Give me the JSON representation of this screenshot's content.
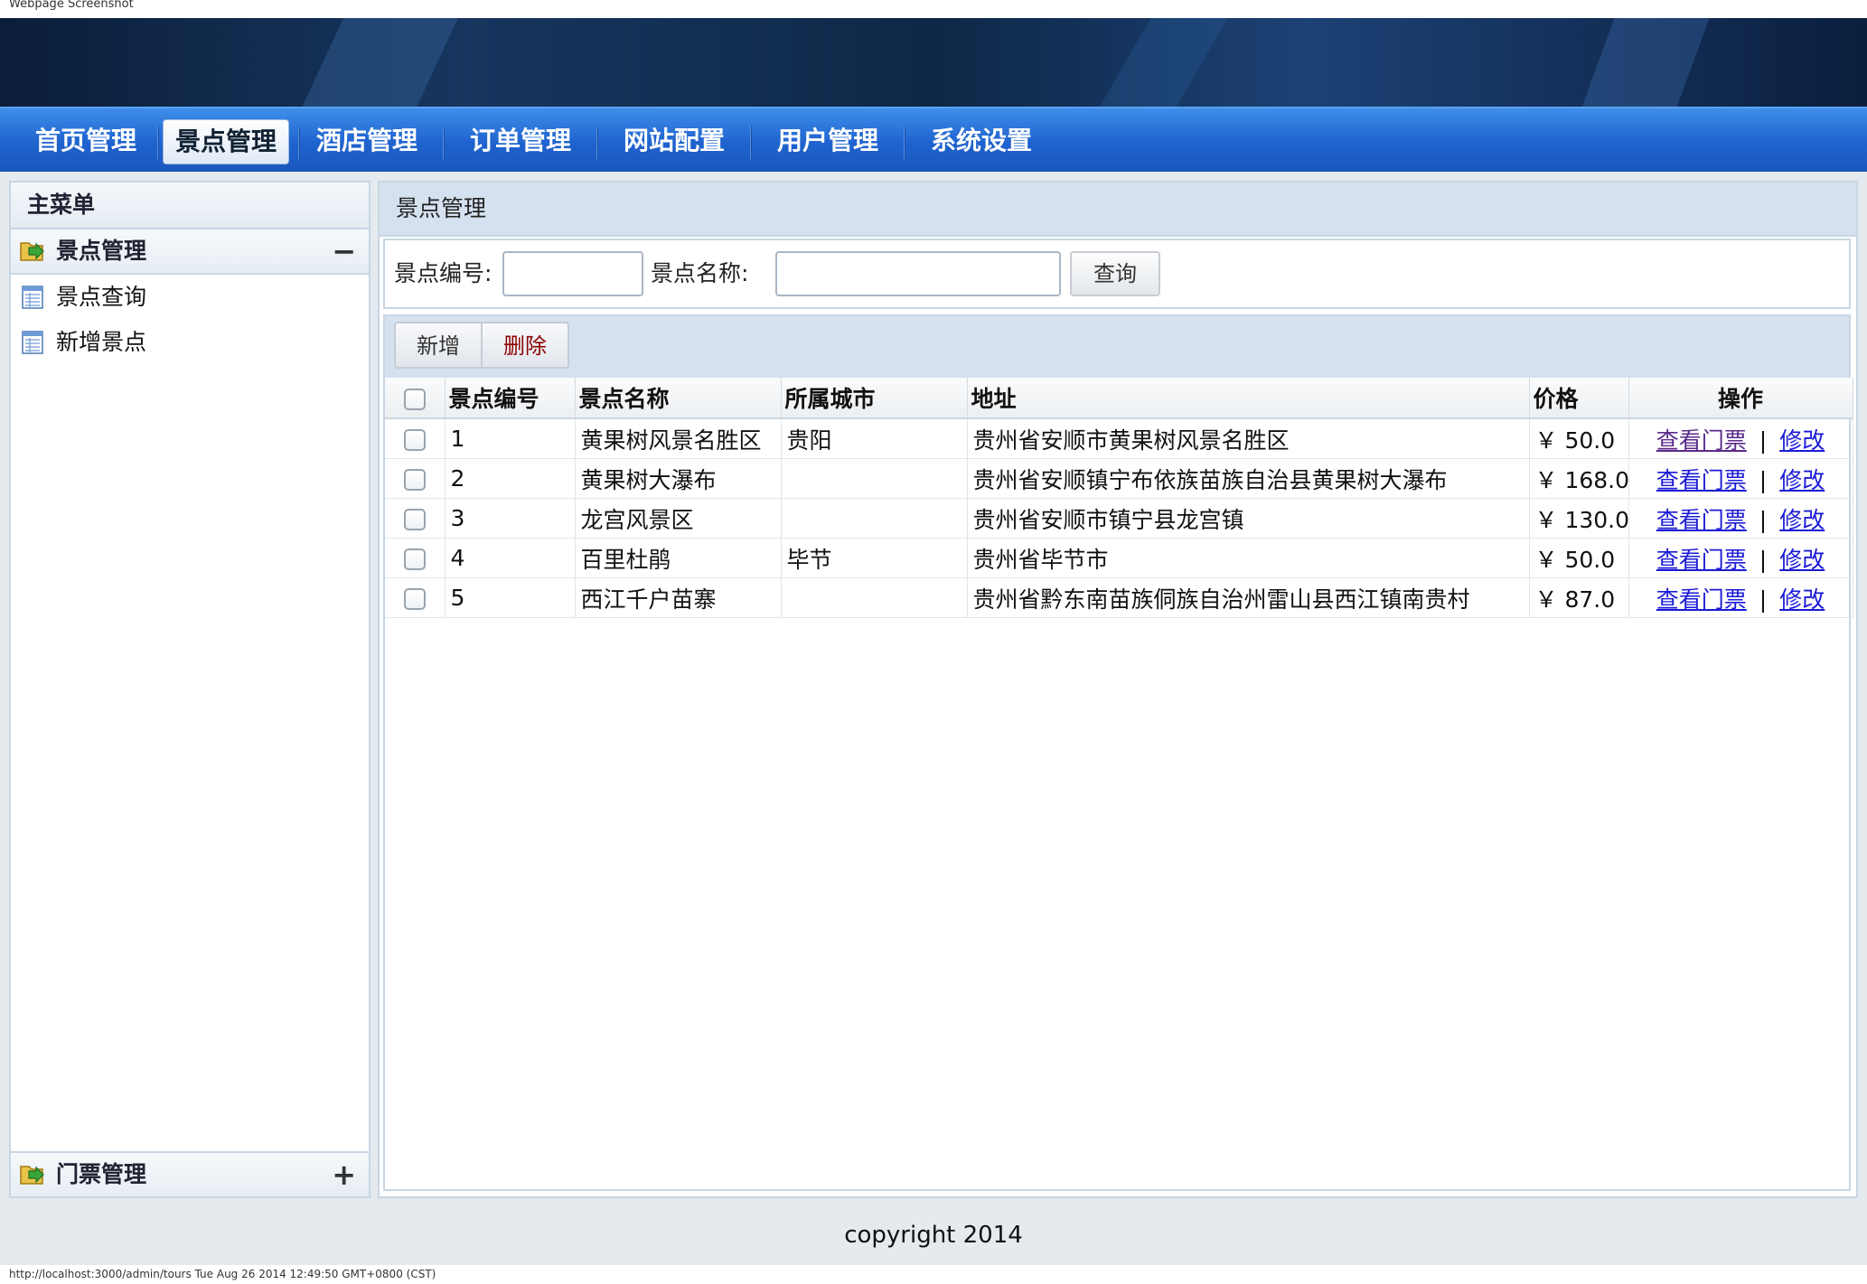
{
  "caption": "Webpage Screenshot",
  "nav": {
    "tabs": [
      "首页管理",
      "景点管理",
      "酒店管理",
      "订单管理",
      "网站配置",
      "用户管理",
      "系统设置"
    ],
    "active_index": 1
  },
  "sidebar": {
    "title": "主菜单",
    "section1": {
      "label": "景点管理",
      "toggle": "−"
    },
    "items": [
      "景点查询",
      "新增景点"
    ],
    "section2": {
      "label": "门票管理",
      "toggle": "+"
    }
  },
  "main": {
    "title": "景点管理",
    "search": {
      "id_label": "景点编号:",
      "name_label": "景点名称:",
      "id_value": "",
      "name_value": "",
      "query_button": "查询"
    },
    "toolbar": {
      "add": "新增",
      "delete": "删除"
    },
    "table": {
      "headers": [
        "景点编号",
        "景点名称",
        "所属城市",
        "地址",
        "价格",
        "操作"
      ],
      "rows": [
        {
          "id": "1",
          "name": "黄果树风景名胜区",
          "city": "贵阳",
          "address": "贵州省安顺市黄果树风景名胜区",
          "price": "￥ 50.0"
        },
        {
          "id": "2",
          "name": "黄果树大瀑布",
          "city": "",
          "address": "贵州省安顺镇宁布依族苗族自治县黄果树大瀑布",
          "price": "￥ 168.0"
        },
        {
          "id": "3",
          "name": "龙宫风景区",
          "city": "",
          "address": "贵州省安顺市镇宁县龙宫镇",
          "price": "￥ 130.0"
        },
        {
          "id": "4",
          "name": "百里杜鹃",
          "city": "毕节",
          "address": "贵州省毕节市",
          "price": "￥ 50.0"
        },
        {
          "id": "5",
          "name": "西江千户苗寨",
          "city": "",
          "address": "贵州省黔东南苗族侗族自治州雷山县西江镇南贵村",
          "price": "￥ 87.0"
        }
      ],
      "op_view": "查看门票",
      "op_sep": "|",
      "op_edit": "修改"
    }
  },
  "footer": "copyright 2014",
  "status_bar": "http://localhost:3000/admin/tours Tue Aug 26 2014 12:49:50 GMT+0800 (CST)",
  "colors": {
    "nav": "#1f63cf",
    "panel_header": "#d5e1ef",
    "link": "#1a1ad6",
    "delete_text": "#8b0000"
  }
}
